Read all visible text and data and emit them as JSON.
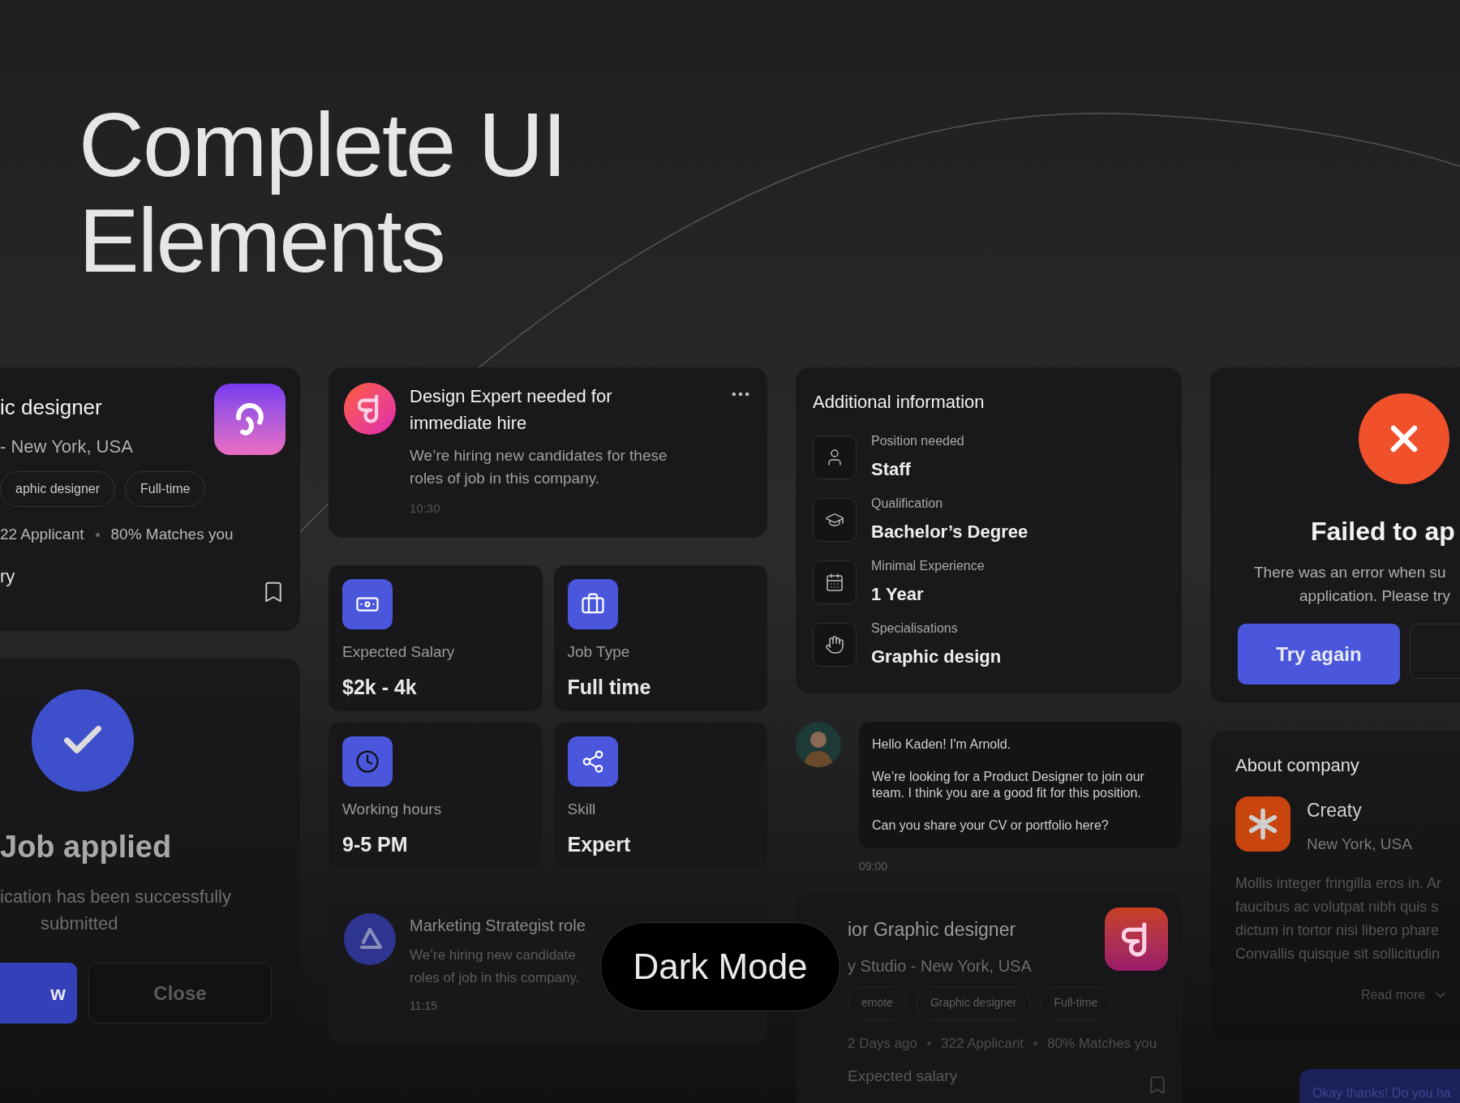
{
  "headline": {
    "lines": [
      "Complete UI",
      "Elements"
    ]
  },
  "job_listing": {
    "title": "ic designer",
    "location": "- New York, USA",
    "tags": [
      "aphic designer",
      "Full-time"
    ],
    "stats": [
      "22 Applicant",
      "80% Matches you"
    ],
    "salary_label": "ry"
  },
  "success_dialog": {
    "title": "Job applied",
    "message": [
      "ication has been successfully",
      "submitted"
    ],
    "buttons": [
      {
        "label": "w",
        "kind": "primary"
      },
      {
        "label": "Close",
        "kind": "secondary"
      }
    ]
  },
  "notification": {
    "title": "Design Expert needed for immediate hire",
    "body": "We’re hiring new candidates for these roles of job in this company.",
    "time": "10:30"
  },
  "job_details": [
    {
      "label": "Expected Salary",
      "value": "$2k - 4k"
    },
    {
      "label": "Job Type",
      "value": "Full time"
    },
    {
      "label": "Working hours",
      "value": "9-5 PM"
    },
    {
      "label": "Skill",
      "value": "Expert"
    }
  ],
  "notification_faded": {
    "title": "Marketing Strategist role",
    "body": [
      "We’re hiring new candidate",
      "roles of job in this company."
    ],
    "time": "11:15"
  },
  "additional_information": {
    "title": "Additional information",
    "items": [
      {
        "label": "Position needed",
        "value": "Staff"
      },
      {
        "label": "Qualification",
        "value": "Bachelor’s Degree"
      },
      {
        "label": "Minimal Experience",
        "value": "1 Year"
      },
      {
        "label": "Specialisations",
        "value": "Graphic design"
      }
    ]
  },
  "chat_message": {
    "paragraphs": [
      "Hello Kaden! I'm Arnold.",
      "We’re looking for a Product Designer to join our team. I think you are a good fit for this position.",
      "Can you share your CV or portfolio here?"
    ],
    "time": "09:00"
  },
  "job_listing_faded": {
    "title": "ior Graphic designer",
    "location": "y Studio - New York, USA",
    "tags": [
      "emote",
      "Graphic designer",
      "Full-time"
    ],
    "stats": [
      "2 Days ago",
      "322 Applicant",
      "80% Matches you"
    ],
    "salary_label": "Expected salary"
  },
  "error_dialog": {
    "title": "Failed to ap",
    "message": [
      "There was an error when su",
      "application. Please try"
    ],
    "buttons": [
      {
        "label": "Try again",
        "kind": "primary"
      }
    ]
  },
  "about_company": {
    "title": "About company",
    "company": "Creaty",
    "location": "New York, USA",
    "description": [
      "Mollis integer fringilla eros in. Ar",
      "faucibus ac volutpat nibh quis s",
      "dictum in tortor nisi libero phare",
      "Convallis quisque sit sollicitudin"
    ],
    "link": "Read more"
  },
  "reply_bubble": {
    "text": "Okay thanks! Do you ha"
  },
  "mode_badge": {
    "label": "Dark Mode"
  }
}
